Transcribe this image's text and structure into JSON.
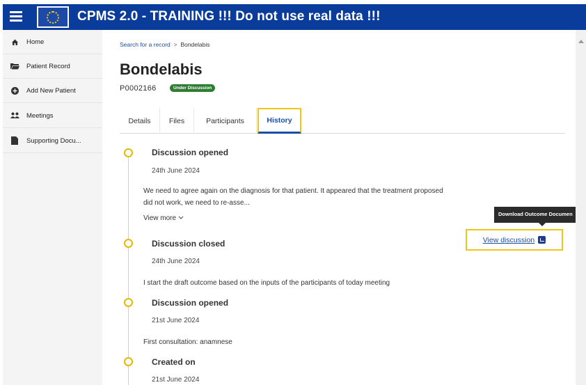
{
  "header": {
    "app_title": "CPMS 2.0 - TRAINING !!! Do not use real data !!!",
    "menu_icon": "hamburger-icon",
    "logo": "eu-flag-logo"
  },
  "sidebar": {
    "items": [
      {
        "label": "Home",
        "icon": "home-icon"
      },
      {
        "label": "Patient Record",
        "icon": "folder-icon"
      },
      {
        "label": "Add New Patient",
        "icon": "plus-circle-icon"
      },
      {
        "label": "Meetings",
        "icon": "people-icon"
      },
      {
        "label": "Supporting Docu...",
        "icon": "document-icon"
      }
    ]
  },
  "breadcrumb": {
    "link": "Search for a record",
    "separator": ">",
    "current": "Bondelabis"
  },
  "record": {
    "title": "Bondelabis",
    "id": "P0002166",
    "status": "Under Discussion"
  },
  "tabs": [
    {
      "label": "Details",
      "active": false
    },
    {
      "label": "Files",
      "active": false
    },
    {
      "label": "Participants",
      "active": false
    },
    {
      "label": "History",
      "active": true
    }
  ],
  "history": [
    {
      "title": "Discussion opened",
      "date": "24th June 2024",
      "text_line1": "We need to agree again on the diagnosis for that patient. It appeared that the treatment proposed",
      "text_line2": "did not work, we need to re-asse...",
      "more": "View more"
    },
    {
      "title": "Discussion closed",
      "date": "24th June 2024",
      "text_line1": "I start the draft outcome based on the inputs of the participants of today meeting",
      "action": "View discussion"
    },
    {
      "title": "Discussion opened",
      "date": "21st June 2024",
      "text_line1": "First consultation: anamnese"
    },
    {
      "title": "Created on",
      "date": "21st June 2024"
    }
  ],
  "tooltip": {
    "text": "Download Outcome Documen"
  },
  "colors": {
    "header_bg": "#0a3c9c",
    "accent_link": "#1a4fa8",
    "badge_green": "#2e7d32",
    "highlight_yellow": "#f0c419",
    "timeline_dot": "#e6b800"
  }
}
